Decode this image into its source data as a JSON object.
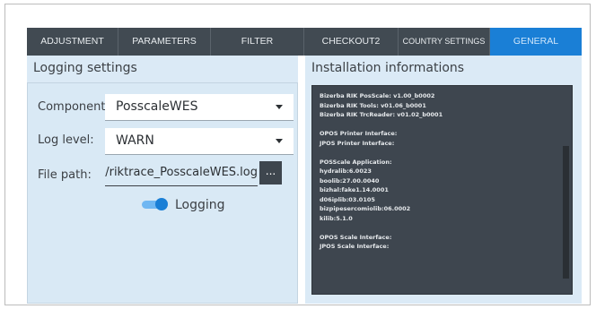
{
  "tabs": [
    {
      "label": "ADJUSTMENT",
      "active": false
    },
    {
      "label": "PARAMETERS",
      "active": false
    },
    {
      "label": "FILTER",
      "active": false
    },
    {
      "label": "CHECKOUT2",
      "active": false
    },
    {
      "label": "COUNTRY SETTINGS",
      "active": false
    },
    {
      "label": "GENERAL",
      "active": true
    }
  ],
  "logging": {
    "title": "Logging settings",
    "component_label": "Component:",
    "component_value": "PosscaleWES",
    "loglevel_label": "Log level:",
    "loglevel_value": "WARN",
    "filepath_label": "File path:",
    "filepath_value": "/log/riktrace_PosscaleWES.log",
    "browse_label": "...",
    "logging_toggle_label": "Logging",
    "logging_enabled": true
  },
  "installation": {
    "title": "Installation informations",
    "lines": [
      "Bizerba RIK PosScale: v1.00_b0002",
      "Bizerba RIK Tools: v01.06_b0001",
      "Bizerba RIK TrcReader: v01.02_b0001",
      "",
      "OPOS Printer Interface:",
      "JPOS Printer Interface:",
      "",
      "POSScale Application:",
      "hydralib:6.0023",
      "boolib:27.00.0040",
      "bizhal:fake1.14.0001",
      "d06iplib:03.0105",
      "bizpipesercomiolib:06.0002",
      "kilib:5.1.0",
      "",
      "OPOS Scale Interface:",
      "JPOS Scale Interface:"
    ]
  },
  "colors": {
    "tabbar_bg": "#414a52",
    "active_tab": "#1a7fd6",
    "panel_bg": "#dbeaf6",
    "console_bg": "#3e464f"
  }
}
